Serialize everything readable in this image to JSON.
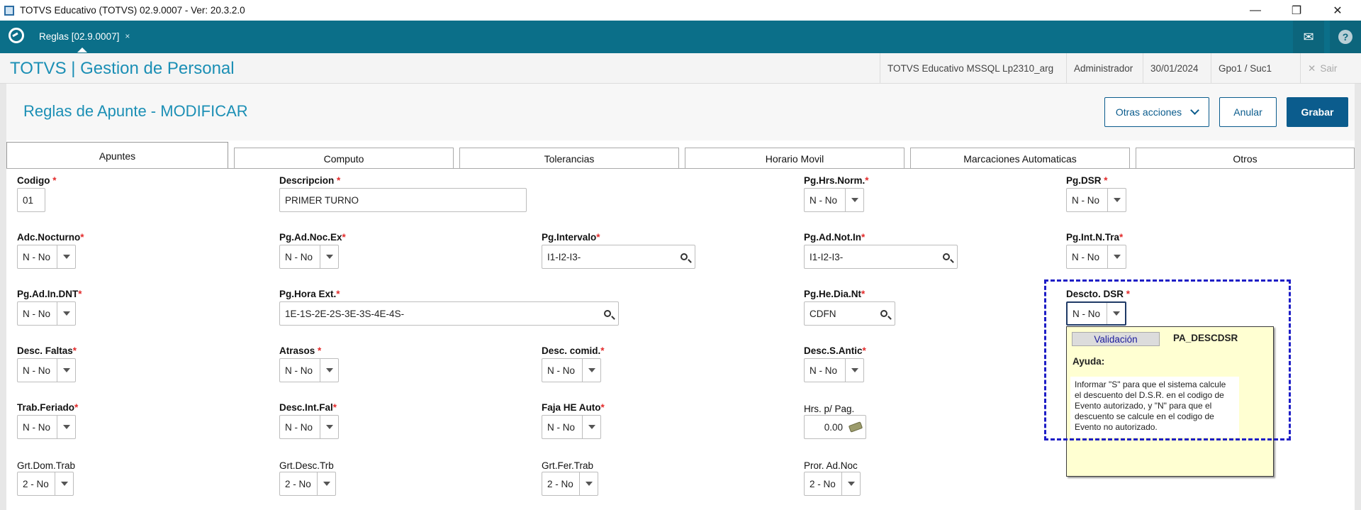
{
  "window": {
    "title": "TOTVS Educativo (TOTVS) 02.9.0007 - Ver: 20.3.2.0",
    "controls": {
      "minimize": "—",
      "maximize": "❐",
      "close": "✕"
    }
  },
  "appbar": {
    "tab_label": "Reglas [02.9.0007]",
    "tab_close": "×",
    "mail_icon": "✉",
    "help_icon": "?"
  },
  "module": {
    "title": "TOTVS | Gestion de Personal",
    "environment": "TOTVS Educativo MSSQL Lp2310_arg",
    "user": "Administrador",
    "date": "30/01/2024",
    "branch": "Gpo1 / Suc1",
    "exit_label": "Sair",
    "exit_icon": "✕"
  },
  "page": {
    "title": "Reglas de Apunte - MODIFICAR",
    "actions": {
      "more": "Otras acciones",
      "cancel": "Anular",
      "save": "Grabar"
    }
  },
  "tabs": [
    "Apuntes",
    "Computo",
    "Tolerancias",
    "Horario Movil",
    "Marcaciones Automaticas",
    "Otros"
  ],
  "required_mark": "*",
  "fields": {
    "codigo": {
      "label": "Codigo",
      "value": "01"
    },
    "descripcion": {
      "label": "Descripcion",
      "value": "PRIMER TURNO"
    },
    "pg_hrs_norm": {
      "label": "Pg.Hrs.Norm.",
      "value": "N - No"
    },
    "pg_dsr": {
      "label": "Pg.DSR",
      "value": "N - No"
    },
    "adc_nocturno": {
      "label": "Adc.Nocturno",
      "value": "N - No"
    },
    "pg_ad_noc_ex": {
      "label": "Pg.Ad.Noc.Ex",
      "value": "N - No"
    },
    "pg_intervalo": {
      "label": "Pg.Intervalo",
      "value": "I1-I2-I3-"
    },
    "pg_ad_not_in": {
      "label": "Pg.Ad.Not.In",
      "value": "I1-I2-I3-"
    },
    "pg_int_n_tra": {
      "label": "Pg.Int.N.Tra",
      "value": "N - No"
    },
    "pg_ad_in_dnt": {
      "label": "Pg.Ad.In.DNT",
      "value": "N - No"
    },
    "pg_hora_ext": {
      "label": "Pg.Hora Ext.",
      "value": "1E-1S-2E-2S-3E-3S-4E-4S-"
    },
    "pg_he_dia_nt": {
      "label": "Pg.He.Dia.Nt",
      "value": "CDFN"
    },
    "descto_dsr": {
      "label": "Descto. DSR",
      "value": "N - No"
    },
    "desc_faltas": {
      "label": "Desc. Faltas",
      "value": "N - No"
    },
    "atrasos": {
      "label": "Atrasos",
      "value": "N - No"
    },
    "desc_comid": {
      "label": "Desc. comid.",
      "value": "N - No"
    },
    "desc_s_antic": {
      "label": "Desc.S.Antic",
      "value": "N - No"
    },
    "trab_feriado": {
      "label": "Trab.Feriado",
      "value": "N - No"
    },
    "desc_int_fal": {
      "label": "Desc.Int.Fal",
      "value": "N - No"
    },
    "faja_he_auto": {
      "label": "Faja HE Auto",
      "value": "N - No"
    },
    "hrs_p_pag": {
      "label": "Hrs. p/ Pag.",
      "value": "0.00"
    },
    "grt_dom_trab": {
      "label": "Grt.Dom.Trab",
      "value": "2 - No"
    },
    "grt_desc_trb": {
      "label": "Grt.Desc.Trb",
      "value": "2 - No"
    },
    "grt_fer_trab": {
      "label": "Grt.Fer.Trab",
      "value": "2 - No"
    },
    "pror_ad_noc": {
      "label": "Pror. Ad.Noc",
      "value": "2 - No"
    }
  },
  "help_popup": {
    "validation_label": "Validación",
    "param_name": "PA_DESCDSR",
    "help_title": "Ayuda:",
    "text_lines": [
      "Informar \"S\" para que el sistema calcule",
      "el descuento del D.S.R. en el codigo de",
      "Evento autorizado, y \"N\" para que el",
      "descuento se calcule en el codigo de",
      "Evento no autorizado."
    ]
  },
  "colors": {
    "appbar": "#0b6f89",
    "accent": "#1b8fb5",
    "primary_button": "#0b5c8d",
    "required": "#e32b2b",
    "popup_bg": "#ffffd2",
    "highlight_dashes": "#1d1dc6"
  }
}
